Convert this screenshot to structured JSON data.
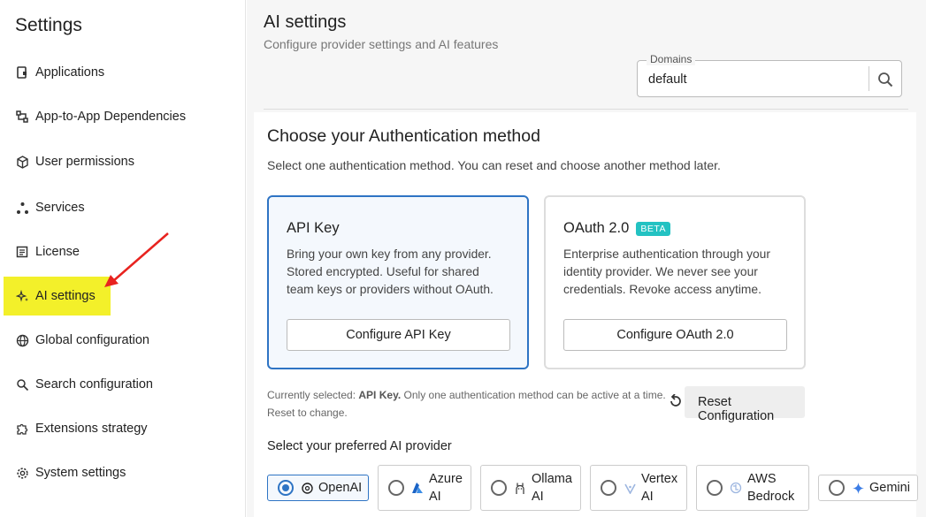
{
  "sidebar": {
    "title": "Settings",
    "items": [
      {
        "label": "Applications",
        "icon": "app-file-icon"
      },
      {
        "label": "App-to-App Dependencies",
        "icon": "dependencies-icon"
      },
      {
        "label": "User permissions",
        "icon": "cube-icon"
      },
      {
        "label": "Services",
        "icon": "services-dots-icon"
      },
      {
        "label": "License",
        "icon": "license-doc-icon"
      },
      {
        "label": "AI settings",
        "icon": "sparkle-icon",
        "active": true
      },
      {
        "label": "Global configuration",
        "icon": "globe-icon"
      },
      {
        "label": "Search configuration",
        "icon": "search-config-icon"
      },
      {
        "label": "Extensions strategy",
        "icon": "puzzle-icon"
      },
      {
        "label": "System settings",
        "icon": "gear-icon"
      }
    ]
  },
  "header": {
    "title": "AI settings",
    "subtitle": "Configure provider settings and AI features"
  },
  "domains": {
    "label": "Domains",
    "value": "default"
  },
  "auth": {
    "title": "Choose your Authentication method",
    "description": "Select one authentication method. You can reset and choose another method later.",
    "api_key": {
      "title": "API Key",
      "description": "Bring your own key from any provider. Stored encrypted. Useful for shared team keys or providers without OAuth.",
      "button": "Configure API Key"
    },
    "oauth": {
      "title": "OAuth 2.0",
      "badge": "BETA",
      "description": "Enterprise authentication through your identity provider. We never see your credentials. Revoke access anytime.",
      "button": "Configure OAuth 2.0"
    },
    "selected_prefix": "Currently selected: ",
    "selected_value": "API Key.",
    "selected_suffix": " Only one authentication method can be active at a time. Reset to change.",
    "reset_button": "Reset Configuration"
  },
  "providers": {
    "title": "Select your preferred AI provider",
    "selected": "OpenAI",
    "items": [
      {
        "label": "OpenAI",
        "line1": "OpenAI",
        "line2": ""
      },
      {
        "label": "Azure AI",
        "line1": "Azure",
        "line2": "AI"
      },
      {
        "label": "Ollama AI",
        "line1": "Ollama",
        "line2": "AI"
      },
      {
        "label": "Vertex AI",
        "line1": "Vertex",
        "line2": "AI"
      },
      {
        "label": "AWS Bedrock",
        "line1": "AWS",
        "line2": "Bedrock"
      },
      {
        "label": "Gemini",
        "line1": "Gemini",
        "line2": ""
      }
    ]
  },
  "colors": {
    "accent": "#2e74c4",
    "highlight": "#f3f02a",
    "annotation_arrow": "#e8231f",
    "beta_badge": "#23c2c2"
  }
}
